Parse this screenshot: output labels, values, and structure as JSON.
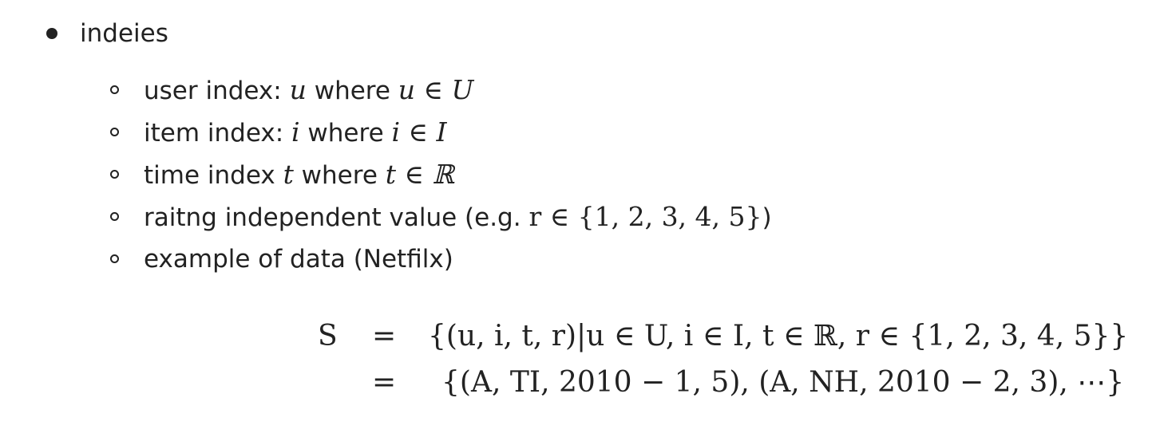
{
  "list": {
    "top_label": "indeies",
    "items": [
      {
        "pre": "user index: ",
        "var": "u",
        "mid": " where ",
        "expr": "u ∈ U",
        "post": ""
      },
      {
        "pre": "item index: ",
        "var": "i",
        "mid": " where ",
        "expr": "i ∈ I",
        "post": ""
      },
      {
        "pre": "time index ",
        "var": "t",
        "mid": " where ",
        "expr": "t ∈ ℝ",
        "post": ""
      },
      {
        "pre": "raitng independent value (e.g. ",
        "var": "",
        "mid": "",
        "expr": "r ∈ {1, 2, 3, 4, 5}",
        "post": ")"
      },
      {
        "pre": "example of data (Netfilx)",
        "var": "",
        "mid": "",
        "expr": "",
        "post": ""
      }
    ]
  },
  "equation": {
    "lhs": "S",
    "rel": "=",
    "line1": "{(u, i, t, r)|u ∈ U,  i ∈ I,  t ∈ ℝ,  r ∈ {1, 2, 3, 4, 5}}",
    "line2": "{(A, TI, 2010 − 1, 5), (A, NH, 2010 − 2, 3), ⋯}"
  }
}
